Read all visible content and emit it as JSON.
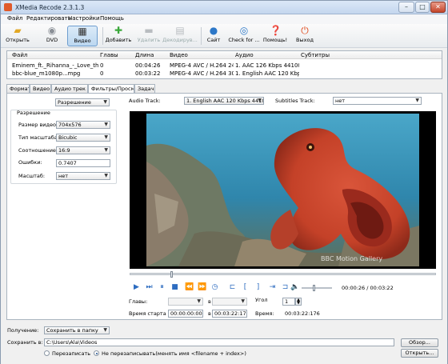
{
  "window": {
    "title": "XMedia Recode 2.3.1.3",
    "controls": {
      "minimize": "–",
      "maximize": "□",
      "close": "✕"
    }
  },
  "menu": [
    "Файл",
    "Редактировать",
    "Настройки",
    "Помощь"
  ],
  "toolbar": {
    "open": "Открыть",
    "dvd": "DVD",
    "video": "Видео",
    "add": "Добавить",
    "delete": "Удалить",
    "decode": "Декодирув...",
    "site": "Сайт",
    "check": "Check for ...",
    "help": "Помощь!",
    "exit": "Выход"
  },
  "files": {
    "columns": [
      "Файл",
      "Главы",
      "Длина",
      "Видео",
      "Аудио",
      "Субтитры"
    ],
    "rows": [
      [
        "Eminem_ft._Rihanna_-_Love_the_W...",
        "0",
        "00:04:26",
        "MPEG-4 AVC / H.264 24.0...",
        "1. AAC 126 Kbps 44100 H...",
        ""
      ],
      [
        "bbc-blue_m1080p...mpg",
        "0",
        "00:03:22",
        "MPEG-4 AVC / H.264 30.0...",
        "1. English AAC 120 Kbps ...",
        ""
      ]
    ]
  },
  "tabs": [
    "Формат",
    "Видео",
    "Аудио трек 1",
    "Фильтры/Просмотр",
    "Задачи"
  ],
  "filters": {
    "filter_select": "Разрешение",
    "group_title": "Разрешение",
    "video_size_label": "Размер видео:",
    "video_size": "704x576",
    "scale_type_label": "Тип масштаба:",
    "scale_type": "Bicubic",
    "ratio_label": "Соотношение:",
    "ratio": "16:9",
    "error_label": "Ошибки:",
    "error": "0.7407",
    "scale_label": "Масштаб:",
    "scale": "нет"
  },
  "preview": {
    "audio_label": "Audio Track:",
    "audio_value": "1. English AAC 120 Kbps 44100 Hz 2",
    "subtitles_label": "Subtitles Track:",
    "subtitles_value": "нет",
    "watermark": "BBC Motion Gallery",
    "time": "00:00:26 / 00:03:22",
    "position": 0.13,
    "chapters_label": "Главы:",
    "in_label": "в",
    "angle_label": "Угол",
    "angle_value": "1",
    "start_label": "Время старта",
    "start_value": "00:00:00:000",
    "end_value": "00:03:22:176",
    "time_label": "Время:",
    "total_value": "00:03:22:176"
  },
  "output": {
    "receive_label": "Получение:",
    "receive_value": "Сохранить в папку",
    "save_label": "Сохранить в:",
    "save_path": "C:\\Users\\Ala\\Videos",
    "browse": "Обзор...",
    "open": "Открыть...",
    "overwrite": "Перезаписать",
    "no_overwrite": "Не перезаписывать(менять имя <filename + index>)"
  },
  "colors": {
    "accent": "#2d6cc0",
    "coral": "#c94a2d"
  }
}
